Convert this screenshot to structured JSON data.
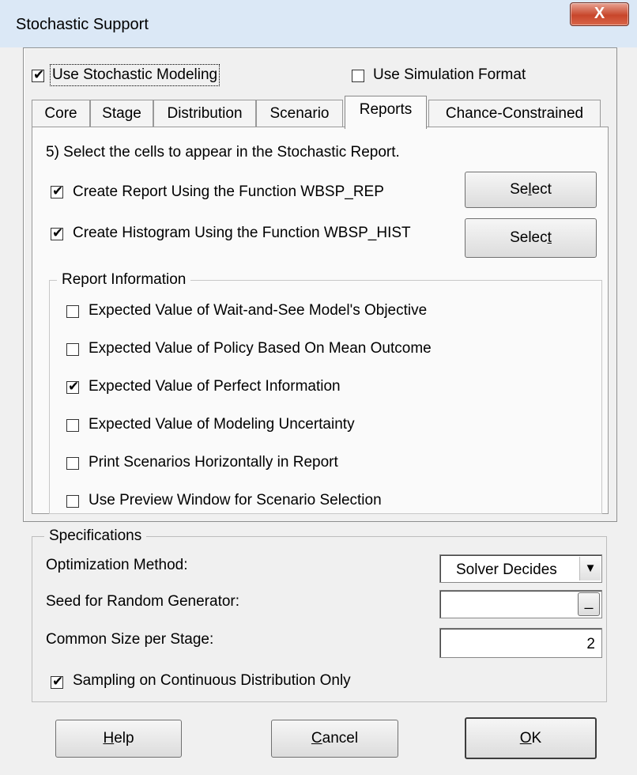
{
  "window": {
    "title": "Stochastic Support",
    "close_glyph": "X"
  },
  "top_options": {
    "use_stochastic": {
      "label": "Use Stochastic Modeling",
      "checked": true
    },
    "use_simulation": {
      "label": "Use Simulation Format",
      "checked": false
    }
  },
  "tabs": [
    {
      "label": "Core"
    },
    {
      "label": "Stage"
    },
    {
      "label": "Distribution"
    },
    {
      "label": "Scenario"
    },
    {
      "label": "Reports",
      "active": true
    },
    {
      "label": "Chance-Constrained"
    }
  ],
  "reports": {
    "instruction": "5) Select the cells to appear in the Stochastic Report.",
    "create_report": {
      "label": "Create Report Using the Function WBSP_REP",
      "checked": true
    },
    "create_histogram": {
      "label": "Create Histogram Using the Function WBSP_HIST",
      "checked": true
    },
    "select_btn_1": {
      "pre": "Se",
      "key": "l",
      "post": "ect"
    },
    "select_btn_2": {
      "pre": "Selec",
      "key": "t",
      "post": ""
    },
    "report_info": {
      "title": "Report Information",
      "items": [
        {
          "label": "Expected Value of Wait-and-See Model's Objective",
          "checked": false
        },
        {
          "label": "Expected Value of Policy Based On Mean Outcome",
          "checked": false
        },
        {
          "label": "Expected Value of Perfect Information",
          "checked": true
        },
        {
          "label": "Expected Value of Modeling Uncertainty",
          "checked": false
        },
        {
          "label": "Print Scenarios Horizontally in Report",
          "checked": false
        },
        {
          "label": "Use Preview Window for Scenario Selection",
          "checked": false
        }
      ]
    }
  },
  "specifications": {
    "title": "Specifications",
    "optimization_method": {
      "label": "Optimization Method:",
      "value": "Solver Decides"
    },
    "seed": {
      "label": "Seed for Random Generator:",
      "value": "",
      "button": "_"
    },
    "common_size": {
      "label": "Common Size per Stage:",
      "value": "2"
    },
    "sampling": {
      "label": "Sampling on Continuous Distribution Only",
      "checked": true
    }
  },
  "buttons": {
    "help": {
      "key": "H",
      "rest": "elp"
    },
    "cancel": {
      "key": "C",
      "rest": "ancel"
    },
    "ok": {
      "key": "O",
      "rest": "K"
    }
  }
}
